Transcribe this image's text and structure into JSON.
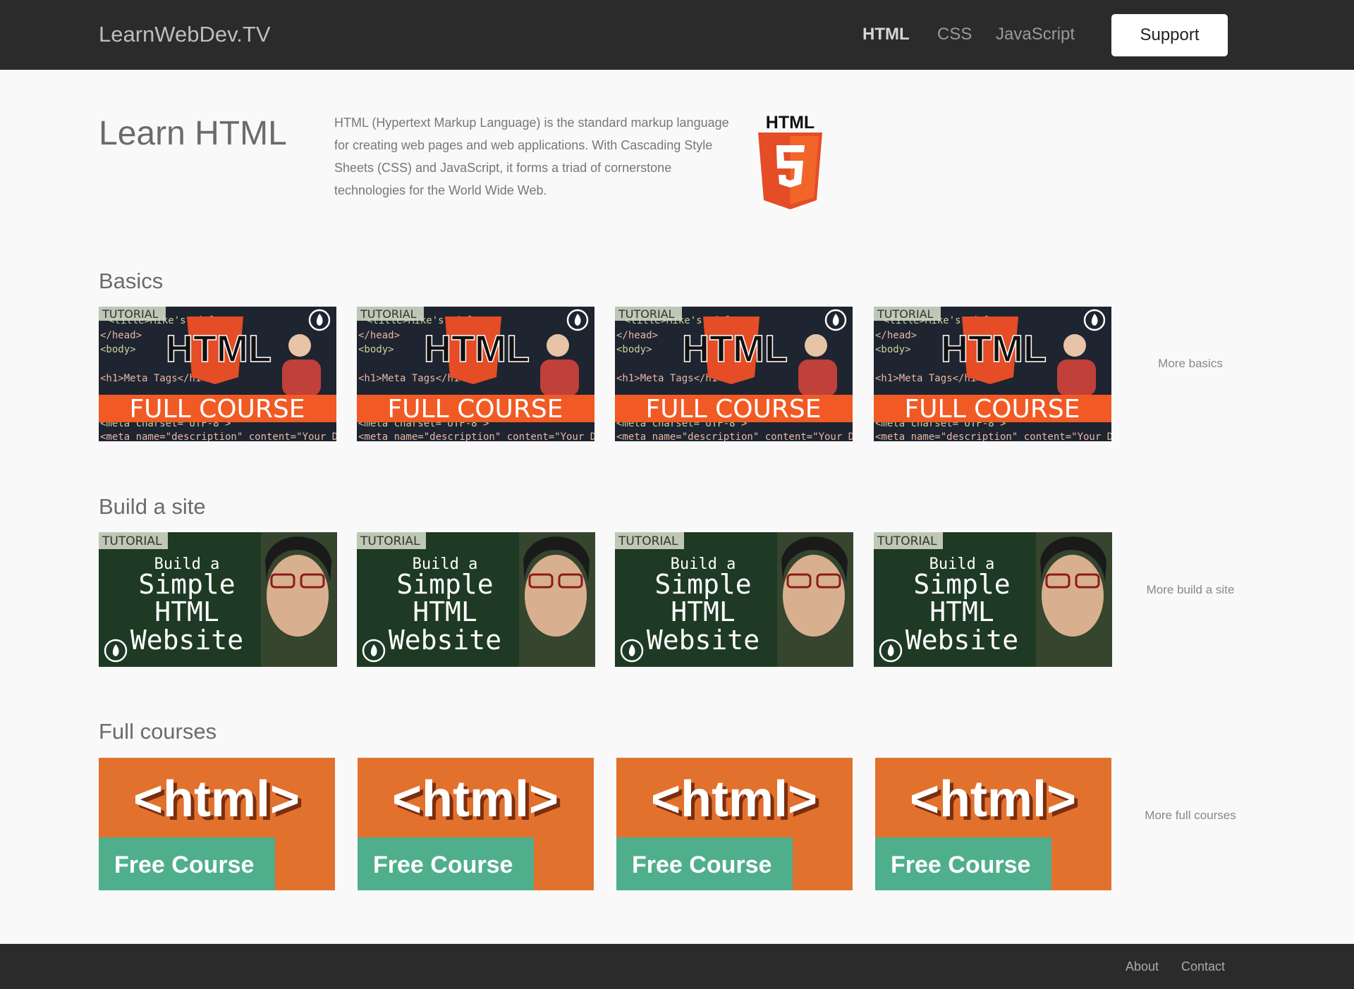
{
  "header": {
    "brand": "LearnWebDev.TV",
    "nav": [
      "HTML",
      "CSS",
      "JavaScript"
    ],
    "support_label": "Support"
  },
  "hero": {
    "title": "Learn HTML",
    "description": "HTML (Hypertext Markup Language) is the standard markup language for creating web pages and web applications. With Cascading Style Sheets (CSS) and JavaScript, it forms a triad of cornerstone technologies for the World Wide Web.",
    "logo_text": "HTML",
    "logo_number": "5",
    "colors": {
      "logo_orange": "#e44d26",
      "logo_dark": "#f16529"
    }
  },
  "sections": [
    {
      "title": "Basics",
      "more": "More basics",
      "thumb": {
        "tag": "TUTORIAL",
        "big": "HTML",
        "banner": "FULL COURSE",
        "code_lines": [
          "<title>Mike's title>",
          "</head>",
          "<body>",
          "<h1>Meta Tags</h1>",
          "<meta charset=\"UTF-8\">",
          "<meta name=\"description\" content=\"Your De"
        ]
      }
    },
    {
      "title": "Build a site",
      "more": "More build a site",
      "thumb": {
        "tag": "TUTORIAL",
        "lines": [
          "Build a",
          "Simple",
          "HTML",
          "Website"
        ]
      }
    },
    {
      "title": "Full courses",
      "more": "More full courses",
      "thumb": {
        "big": "<html>",
        "banner": "Free Course"
      }
    }
  ],
  "footer": {
    "links": [
      "About",
      "Contact"
    ]
  }
}
